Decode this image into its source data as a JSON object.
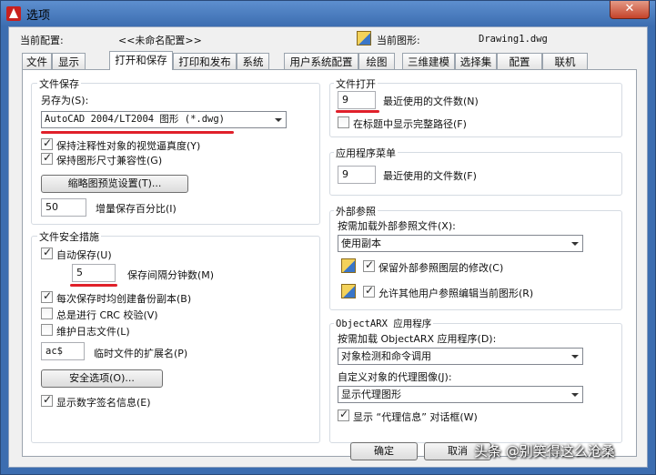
{
  "window": {
    "title": "选项",
    "close_label": "✕"
  },
  "profile": {
    "label": "当前配置:",
    "value": "<<未命名配置>>",
    "drawing_label": "当前图形:",
    "drawing_value": "Drawing1.dwg"
  },
  "tabs": [
    "文件",
    "显示",
    "打开和保存",
    "打印和发布",
    "系统",
    "用户系统配置",
    "绘图",
    "三维建模",
    "选择集",
    "配置",
    "联机"
  ],
  "active_tab": "打开和保存",
  "file_save": {
    "title": "文件保存",
    "save_as_label": "另存为(S):",
    "save_as_value": "AutoCAD 2004/LT2004 图形 (*.dwg)",
    "keep_annotative": "保持注释性对象的视觉逼真度(Y)",
    "keep_size_compat": "保持图形尺寸兼容性(G)",
    "thumbnail_button": "缩略图预览设置(T)...",
    "incremental_value": "50",
    "incremental_label": "增量保存百分比(I)"
  },
  "file_safety": {
    "title": "文件安全措施",
    "autosave_label": "自动保存(U)",
    "interval_value": "5",
    "interval_label": "保存间隔分钟数(M)",
    "backup_label": "每次保存时均创建备份副本(B)",
    "crc_label": "总是进行 CRC 校验(V)",
    "log_label": "维护日志文件(L)",
    "temp_ext_value": "ac$",
    "temp_ext_label": "临时文件的扩展名(P)",
    "security_button": "安全选项(O)...",
    "digital_sig_label": "显示数字签名信息(E)"
  },
  "file_open": {
    "title": "文件打开",
    "recent_value": "9",
    "recent_label": "最近使用的文件数(N)",
    "full_path_label": "在标题中显示完整路径(F)"
  },
  "app_menu": {
    "title": "应用程序菜单",
    "recent_value": "9",
    "recent_label": "最近使用的文件数(F)"
  },
  "xref": {
    "title": "外部参照",
    "demand_label": "按需加载外部参照文件(X):",
    "demand_value": "使用副本",
    "retain_label": "保留外部参照图层的修改(C)",
    "allow_edit_label": "允许其他用户参照编辑当前图形(R)"
  },
  "objectarx": {
    "title": "ObjectARX 应用程序",
    "demand_label": "按需加载 ObjectARX 应用程序(D):",
    "demand_value": "对象检测和命令调用",
    "proxy_label": "自定义对象的代理图像(J):",
    "proxy_value": "显示代理图形",
    "proxy_info_label": "显示 “代理信息” 对话框(W)"
  },
  "buttons": {
    "ok": "确定",
    "cancel": "取消"
  },
  "watermark": "头条 @别笑得这么沧桑",
  "colors": {
    "annotation_red": "#e0202a",
    "title_bar": "#3c6db0"
  },
  "checkboxes": {
    "keep_annotative": true,
    "keep_size_compat": true,
    "autosave": true,
    "backup": true,
    "crc": false,
    "log": false,
    "digital_sig": true,
    "full_path": false,
    "retain": true,
    "allow_edit": true,
    "proxy_info": true
  }
}
